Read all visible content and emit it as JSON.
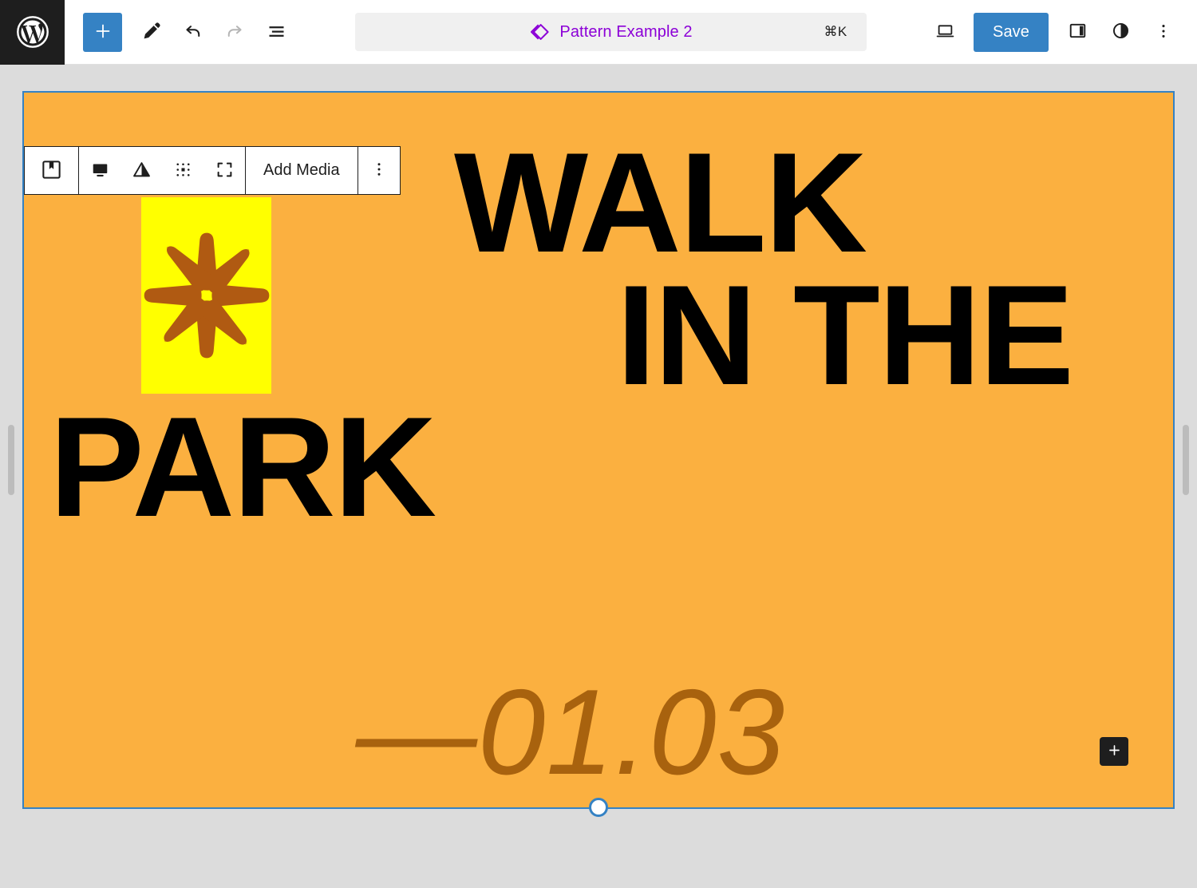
{
  "app": {
    "name": "WordPress Block Editor",
    "accent_blue": "#3582c4",
    "logo_bg": "#1e1e1e",
    "canvas_bg": "#dcdcdc"
  },
  "topbar": {
    "logo_icon": "wordpress-logo-icon",
    "left_tools": [
      {
        "name": "block-inserter-toggle",
        "icon": "plus-icon",
        "label": "",
        "primary": true,
        "disabled": false
      },
      {
        "name": "tools-edit-mode",
        "icon": "pencil-icon",
        "label": "",
        "primary": false,
        "disabled": false
      },
      {
        "name": "undo-button",
        "icon": "undo-arrow-icon",
        "label": "",
        "primary": false,
        "disabled": false
      },
      {
        "name": "redo-button",
        "icon": "redo-arrow-icon",
        "label": "",
        "primary": false,
        "disabled": true
      },
      {
        "name": "document-overview-button",
        "icon": "list-view-icon",
        "label": "",
        "primary": false,
        "disabled": false
      }
    ],
    "document_title": {
      "icon": "pattern-diamond-icon",
      "text": "Pattern Example 2",
      "shortcut": "⌘K",
      "color": "#8c00d7",
      "background": "#f0f0f0"
    },
    "right_tools": [
      {
        "name": "preview-device-button",
        "icon": "desktop-laptop-icon"
      },
      {
        "name": "settings-sidebar-toggle",
        "icon": "sidebar-panel-icon"
      },
      {
        "name": "styles-contrast-button",
        "icon": "contrast-circle-icon"
      },
      {
        "name": "more-options-button",
        "icon": "three-dots-vertical-icon"
      }
    ],
    "save_label": "Save"
  },
  "block_toolbar": {
    "block_type_icon": "cover-block-icon",
    "tools": [
      {
        "name": "replace-media-button",
        "icon": "media-monitor-icon"
      },
      {
        "name": "duotone-filter-button",
        "icon": "duotone-triangle-icon"
      },
      {
        "name": "focal-point-button",
        "icon": "dot-grid-icon"
      },
      {
        "name": "full-height-toggle-button",
        "icon": "crop-brackets-icon"
      }
    ],
    "add_media_label": "Add Media",
    "options_icon": "three-dots-vertical-icon"
  },
  "cover_block": {
    "background_color": "#fbb040",
    "selection_color": "#3582c4",
    "accent_panel": {
      "background_color": "#ffff00",
      "icon": "eight-point-star-icon",
      "icon_color": "#b05a12"
    },
    "headline": {
      "lines": [
        "WALK",
        "IN THE",
        "PARK"
      ],
      "color": "#000000"
    },
    "subline": {
      "text": "—01.03",
      "color": "#a8620e"
    },
    "appender_icon": "plus-icon"
  },
  "handles": {
    "left_resize": "left-resize-handle",
    "right_resize": "right-resize-handle",
    "bottom_resize": "bottom-resize-handle"
  }
}
